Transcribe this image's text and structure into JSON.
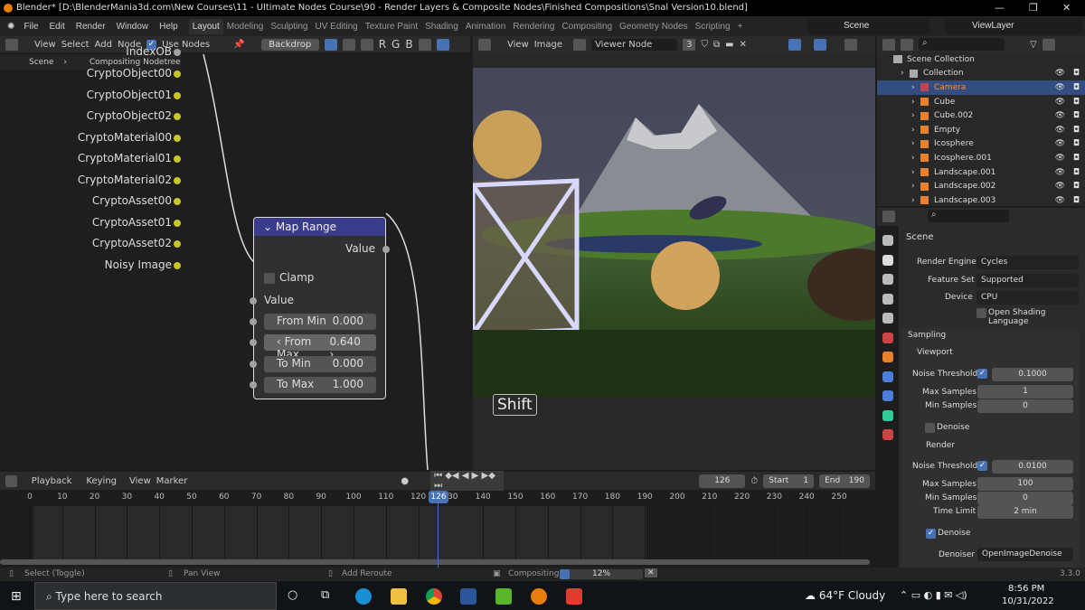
{
  "title_bar": {
    "title": "Blender* [D:\\BlenderMania3d.com\\New Courses\\11 - Ultimate Nodes Course\\90 - Render Layers & Composite Nodes\\Finished Compositions\\Snal Version10.blend]"
  },
  "menu": [
    "File",
    "Edit",
    "Render",
    "Window",
    "Help"
  ],
  "workspaces": [
    "Layout",
    "Modeling",
    "Sculpting",
    "UV Editing",
    "Texture Paint",
    "Shading",
    "Animation",
    "Rendering",
    "Compositing",
    "Geometry Nodes",
    "Scripting"
  ],
  "active_workspace": "Layout",
  "scene_selector": "Scene",
  "view_layer": "ViewLayer",
  "node_editor": {
    "header": {
      "view": "View",
      "select": "Select",
      "add": "Add",
      "node": "Node",
      "use_nodes": "Use Nodes",
      "backdrop": "Backdrop",
      "r": "R",
      "g": "G",
      "b": "B"
    },
    "breadcrumb": [
      "Scene",
      "Compositing Nodetree"
    ],
    "outputs": [
      "IndexOB",
      "CryptoObject00",
      "CryptoObject01",
      "CryptoObject02",
      "CryptoMaterial00",
      "CryptoMaterial01",
      "CryptoMaterial02",
      "CryptoAsset00",
      "CryptoAsset01",
      "CryptoAsset02",
      "Noisy Image"
    ],
    "map_range": {
      "title": "Map Range",
      "output": "Value",
      "clamp": "Clamp",
      "input": "Value",
      "fields": [
        {
          "label": "From Min",
          "value": "0.000"
        },
        {
          "label": "From Max",
          "value": "0.640"
        },
        {
          "label": "To Min",
          "value": "0.000"
        },
        {
          "label": "To Max",
          "value": "1.000"
        }
      ]
    },
    "key_overlay": "Shift"
  },
  "image_editor": {
    "view": "View",
    "image": "Image",
    "image_name": "Viewer Node",
    "users": "3"
  },
  "outliner": {
    "root": "Scene Collection",
    "items": [
      "Collection",
      "Camera",
      "Cube",
      "Cube.002",
      "Empty",
      "Icosphere",
      "Icosphere.001",
      "Landscape.001",
      "Landscape.002",
      "Landscape.003"
    ],
    "selected": "Camera"
  },
  "properties": {
    "context": "Scene",
    "render_engine": {
      "label": "Render Engine",
      "value": "Cycles"
    },
    "feature_set": {
      "label": "Feature Set",
      "value": "Supported"
    },
    "device": {
      "label": "Device",
      "value": "CPU"
    },
    "osl": "Open Shading Language",
    "sampling": "Sampling",
    "viewport": {
      "title": "Viewport",
      "noise_threshold_label": "Noise Threshold",
      "noise_threshold": "0.1000",
      "max_samples_label": "Max Samples",
      "max_samples": "1",
      "min_samples_label": "Min Samples",
      "min_samples": "0",
      "denoise": "Denoise"
    },
    "render": {
      "title": "Render",
      "noise_threshold_label": "Noise Threshold",
      "noise_threshold": "0.0100",
      "max_samples_label": "Max Samples",
      "max_samples": "100",
      "min_samples_label": "Min Samples",
      "min_samples": "0",
      "time_limit_label": "Time Limit",
      "time_limit": "2 min",
      "denoise": "Denoise",
      "denoiser_label": "Denoiser",
      "denoiser": "OpenImageDenoise"
    }
  },
  "timeline": {
    "playback": "Playback",
    "keying": "Keying",
    "view": "View",
    "marker": "Marker",
    "current_frame": "126",
    "start_label": "Start",
    "start": "1",
    "end_label": "End",
    "end": "190",
    "ticks": [
      "0",
      "10",
      "20",
      "30",
      "40",
      "50",
      "60",
      "70",
      "80",
      "90",
      "100",
      "110",
      "120",
      "130",
      "140",
      "150",
      "160",
      "170",
      "180",
      "190",
      "200",
      "210",
      "220",
      "230",
      "240",
      "250"
    ]
  },
  "status_bar": {
    "select": "Select (Toggle)",
    "pan": "Pan View",
    "reroute": "Add Reroute",
    "job": "Compositing",
    "progress": "12%",
    "progress_value": 12,
    "version": "3.3.0"
  },
  "taskbar": {
    "search_placeholder": "Type here to search",
    "weather": "64°F  Cloudy",
    "time": "8:56 PM",
    "date": "10/31/2022"
  },
  "colors": {
    "accent": "#4772b3",
    "node_header": "#3b3b8c",
    "socket_yellow": "#c7c729",
    "selected_text": "#ff8c3a"
  }
}
